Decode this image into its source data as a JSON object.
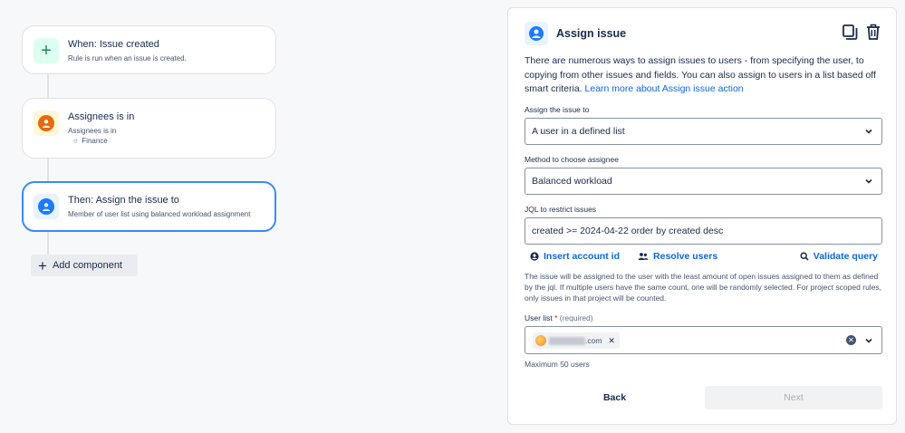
{
  "flow": {
    "trigger": {
      "icon": "plus-icon",
      "title": "When: Issue created",
      "subtitle": "Rule is run when an issue is created."
    },
    "condition": {
      "icon": "user-avatar-icon",
      "title": "Assignees is in",
      "subtitle": "Assignees is in",
      "bullet": "Finance"
    },
    "action": {
      "icon": "user-avatar-icon",
      "title": "Then: Assign the issue to",
      "subtitle": "Member of user list using balanced workload assignment"
    },
    "add_component_label": "Add component"
  },
  "panel": {
    "title": "Assign issue",
    "description": "There are numerous ways to assign issues to users - from specifying the user, to copying from other issues and fields. You can also assign to users in a list based off smart criteria.",
    "learn_more_link": "Learn more about Assign issue action",
    "assign_to": {
      "label": "Assign the issue to",
      "value": "A user in a defined list"
    },
    "method": {
      "label": "Method to choose assignee",
      "value": "Balanced workload"
    },
    "jql": {
      "label": "JQL to restrict issues",
      "value": "created >= 2024-04-22 order by created desc"
    },
    "links": {
      "insert_account": "Insert account id",
      "resolve_users": "Resolve users",
      "validate_query": "Validate query"
    },
    "note": "The issue will be assigned to the user with the least amount of open issues assigned to them as defined by the jql. If multiple users have the same count, one will be randomly selected. For project scoped rules, only issues in that project will be counted.",
    "user_list": {
      "label": "User list",
      "required_mark": "*",
      "required_text": "(required)",
      "chip_suffix": ".com",
      "max_note": "Maximum 50 users"
    },
    "back_label": "Back",
    "next_label": "Next"
  },
  "colors": {
    "accent": "#0c66e4",
    "selected_border": "#388bff",
    "trigger_icon_bg": "#dcfff1",
    "condition_icon_bg": "#fff7d6",
    "action_icon_bg": "#e9f2ff"
  }
}
